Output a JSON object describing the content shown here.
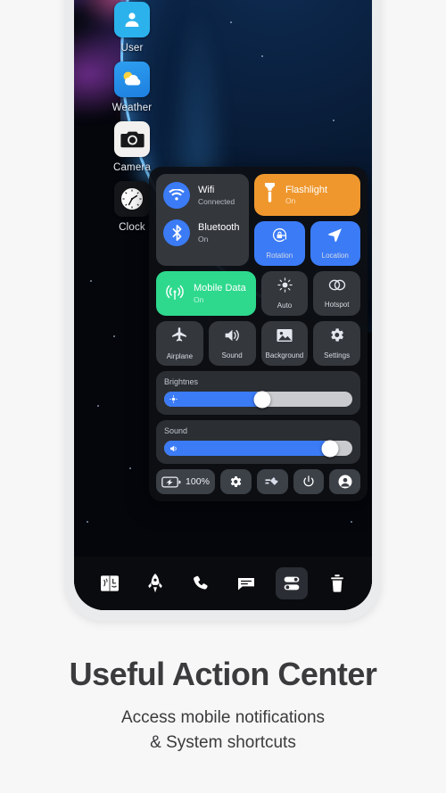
{
  "phone": {
    "home_apps": [
      {
        "label": "User",
        "icon": "user-icon"
      },
      {
        "label": "Weather",
        "icon": "weather-icon"
      },
      {
        "label": "Camera",
        "icon": "camera-icon"
      },
      {
        "label": "Clock",
        "icon": "clock-icon"
      }
    ],
    "action_center": {
      "connectivity": [
        {
          "title": "Wifi",
          "status": "Connected",
          "icon": "wifi-icon",
          "badge_color": "#3b7bf6"
        },
        {
          "title": "Bluetooth",
          "status": "On",
          "icon": "bluetooth-icon",
          "badge_color": "#3b7bf6"
        }
      ],
      "flashlight": {
        "title": "Flashlight",
        "status": "On",
        "icon": "flashlight-icon",
        "color": "#ef972d"
      },
      "rotation": {
        "label": "Rotation",
        "icon": "rotation-lock-icon",
        "color": "#3b7bf6"
      },
      "location": {
        "label": "Location",
        "icon": "location-arrow-icon",
        "color": "#3b7bf6"
      },
      "mobile_data": {
        "title": "Mobile Data",
        "status": "On",
        "icon": "cell-signal-icon",
        "color": "#2ed98d"
      },
      "auto": {
        "label": "Auto",
        "icon": "brightness-auto-icon",
        "color": "#34373c"
      },
      "hotspot": {
        "label": "Hotspot",
        "icon": "hotspot-links-icon",
        "color": "#34373c"
      },
      "airplane": {
        "label": "Airplane",
        "icon": "airplane-icon",
        "color": "#34373c"
      },
      "sound_tile": {
        "label": "Sound",
        "icon": "speaker-icon",
        "color": "#34373c"
      },
      "background": {
        "label": "Background",
        "icon": "image-icon",
        "color": "#34373c"
      },
      "settings": {
        "label": "Settings",
        "icon": "gear-icon",
        "color": "#34373c"
      },
      "sliders": [
        {
          "label": "Brightnes",
          "value": 52,
          "icon": "brightness-icon",
          "fill_color": "#3b7bf6"
        },
        {
          "label": "Sound",
          "value": 88,
          "icon": "volume-icon",
          "fill_color": "#3b7bf6"
        }
      ],
      "quick_actions": [
        {
          "name": "battery",
          "label": "100%",
          "icon": "battery-charging-icon"
        },
        {
          "name": "settings",
          "label": "",
          "icon": "gear-icon"
        },
        {
          "name": "shortcuts",
          "label": "",
          "icon": "shortcut-edit-icon"
        },
        {
          "name": "power",
          "label": "",
          "icon": "power-icon"
        },
        {
          "name": "account",
          "label": "",
          "icon": "account-circle-icon"
        }
      ]
    },
    "dock": [
      {
        "name": "finder",
        "icon": "finder-icon",
        "active": false
      },
      {
        "name": "launchpad",
        "icon": "rocket-icon",
        "active": false
      },
      {
        "name": "phone",
        "icon": "phone-icon",
        "active": false
      },
      {
        "name": "messages",
        "icon": "message-icon",
        "active": false
      },
      {
        "name": "controls",
        "icon": "toggles-icon",
        "active": true
      },
      {
        "name": "trash",
        "icon": "trash-icon",
        "active": false
      }
    ]
  },
  "caption": {
    "title": "Useful Action Center",
    "subtitle_line1": "Access mobile notifications",
    "subtitle_line2": "& System shortcuts"
  }
}
